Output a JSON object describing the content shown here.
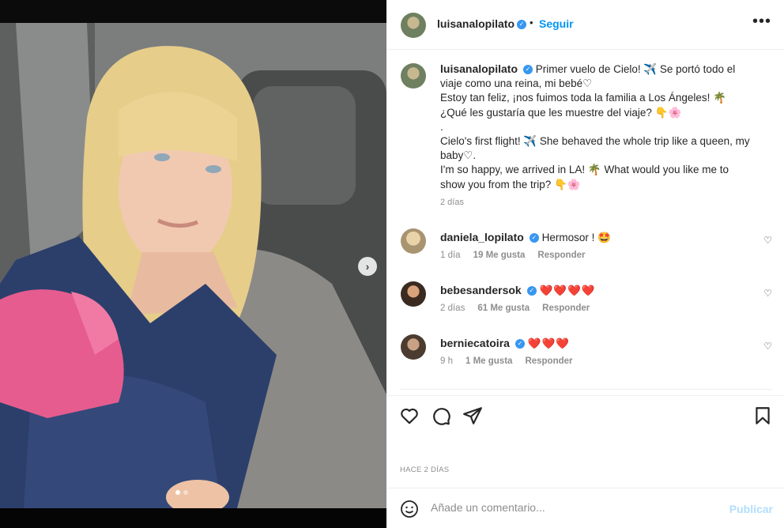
{
  "post": {
    "username": "luisanalopilato",
    "follow_label": "Seguir",
    "separator": "•",
    "more_label": "•••"
  },
  "caption": {
    "username": "luisanalopilato",
    "text_lines": [
      "Primer vuelo de Cielo! ✈️ Se portó todo el viaje como una reina, mi bebé♡",
      "Estoy tan feliz, ¡nos fuimos toda la familia a Los Ángeles! 🌴",
      "¿Qué les gustaría que les muestre del viaje? 👇🌸",
      ".",
      "Cielo's first flight! ✈️ She behaved the whole trip like a queen, my baby♡.",
      "I'm so happy, we arrived in LA! 🌴 What would you like me to show you from the trip? 👇🌸"
    ],
    "time": "2 días"
  },
  "comments": [
    {
      "username": "daniela_lopilato",
      "text": "Hermosor ! 🤩",
      "time": "1 día",
      "likes": "19 Me gusta",
      "reply": "Responder"
    },
    {
      "username": "bebesandersok",
      "text": "❤️❤️❤️❤️",
      "time": "2 días",
      "likes": "61 Me gusta",
      "reply": "Responder"
    },
    {
      "username": "berniecatoira",
      "text": "❤️❤️❤️",
      "time": "9 h",
      "likes": "1 Me gusta",
      "reply": "Responder"
    }
  ],
  "footer": {
    "posted_when": "HACE 2 DÍAS",
    "comment_placeholder": "Añade un comentario...",
    "publish_label": "Publicar"
  },
  "icons": {
    "like": "heart-icon",
    "comment": "comment-icon",
    "share": "paper-plane-icon",
    "save": "bookmark-icon",
    "emoji": "emoji-icon",
    "next": "chevron-right-icon",
    "verified": "verified-badge-icon"
  },
  "colors": {
    "link_blue": "#0095f6",
    "verified_blue": "#3897f0",
    "muted": "#8e8e8e",
    "publish_disabled": "#b2dffc"
  }
}
